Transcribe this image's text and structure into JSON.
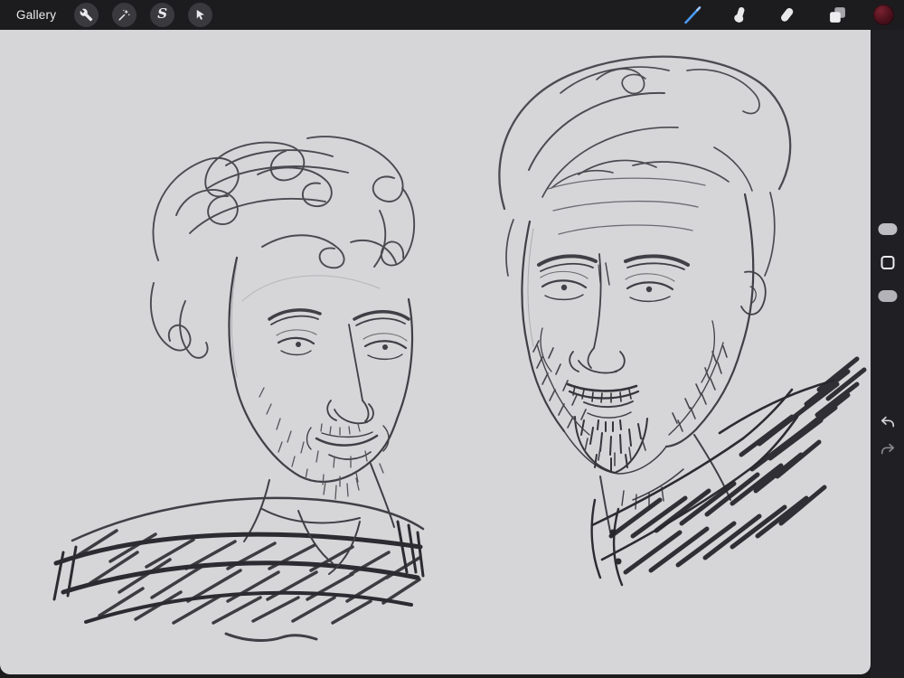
{
  "topbar": {
    "gallery_label": "Gallery",
    "selection_glyph": "S",
    "tools_left": [
      {
        "id": "actions",
        "icon": "wrench-icon"
      },
      {
        "id": "adjustments",
        "icon": "magic-wand-icon"
      },
      {
        "id": "selection",
        "icon": "selection-s-icon"
      },
      {
        "id": "transform",
        "icon": "transform-cursor-icon"
      }
    ],
    "tools_right": [
      {
        "id": "brush",
        "icon": "paintbrush-icon",
        "selected": true
      },
      {
        "id": "smudge",
        "icon": "smudge-finger-icon",
        "selected": false
      },
      {
        "id": "erase",
        "icon": "eraser-icon",
        "selected": false
      },
      {
        "id": "layers",
        "icon": "layers-icon",
        "selected": false
      },
      {
        "id": "color",
        "icon": "color-swatch",
        "color": "#4a101b"
      }
    ]
  },
  "sidebar": {
    "controls": [
      {
        "id": "brush-size-slider",
        "type": "pill"
      },
      {
        "id": "modify-button",
        "type": "square"
      },
      {
        "id": "opacity-slider",
        "type": "pill"
      },
      {
        "id": "undo-button",
        "icon": "undo-arrow-icon"
      },
      {
        "id": "redo-button",
        "icon": "redo-arrow-icon"
      }
    ]
  },
  "canvas": {
    "artwork": "pencil-sketch-two-bearded-male-portraits",
    "background": "#d6d6d8"
  },
  "colors": {
    "topbar_bg": "#1c1c1f",
    "button_bg": "#3a3a3e",
    "accent_blue": "#4a9bf5",
    "sidebar_bg": "#202024",
    "swatch_maroon": "#4a101b",
    "sketch_ink": "#3f3f46"
  }
}
